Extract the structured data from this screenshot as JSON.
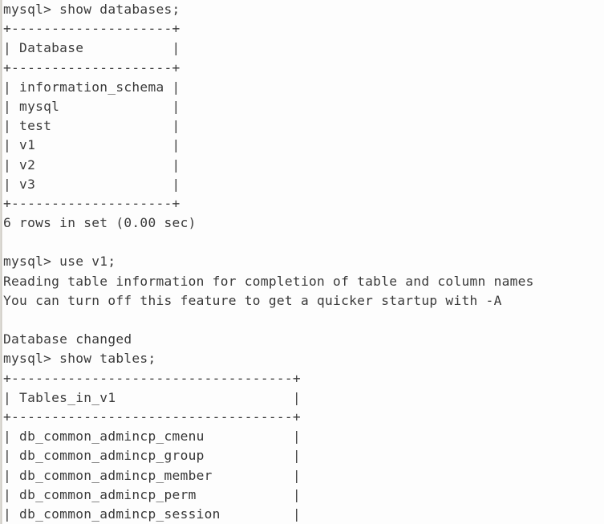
{
  "terminal": {
    "app": "mysql-client-console",
    "prompt": "mysql>",
    "colors": {
      "background": "#fdfdfd",
      "foreground": "#3a3a3a",
      "window_edge": "#c9c6bf"
    },
    "lines": [
      "mysql> show databases;",
      "+--------------------+",
      "| Database           |",
      "+--------------------+",
      "| information_schema |",
      "| mysql              |",
      "| test               |",
      "| v1                 |",
      "| v2                 |",
      "| v3                 |",
      "+--------------------+",
      "6 rows in set (0.00 sec)",
      "",
      "mysql> use v1;",
      "Reading table information for completion of table and column names",
      "You can turn off this feature to get a quicker startup with -A",
      "",
      "Database changed",
      "mysql> show tables;",
      "+-----------------------------------+",
      "| Tables_in_v1                      |",
      "+-----------------------------------+",
      "| db_common_admincp_cmenu           |",
      "| db_common_admincp_group           |",
      "| db_common_admincp_member          |",
      "| db_common_admincp_perm            |",
      "| db_common_admincp_session         |"
    ],
    "commands": [
      "show databases;",
      "use v1;",
      "show tables;"
    ],
    "databases_result": {
      "header": "Database",
      "rows": [
        "information_schema",
        "mysql",
        "test",
        "v1",
        "v2",
        "v3"
      ],
      "status": "6 rows in set (0.00 sec)",
      "row_count": 6,
      "duration": "0.00 sec"
    },
    "use_messages": [
      "Reading table information for completion of table and column names",
      "You can turn off this feature to get a quicker startup with -A",
      "Database changed"
    ],
    "tables_result": {
      "header": "Tables_in_v1",
      "rows": [
        "db_common_admincp_cmenu",
        "db_common_admincp_group",
        "db_common_admincp_member",
        "db_common_admincp_perm",
        "db_common_admincp_session"
      ],
      "truncated": true
    }
  }
}
